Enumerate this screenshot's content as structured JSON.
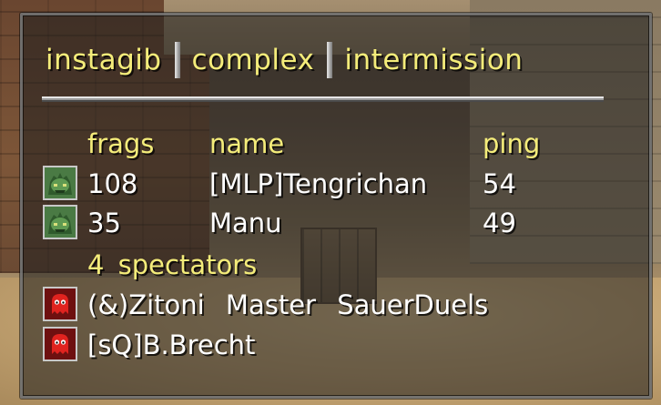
{
  "header": {
    "mode": "instagib",
    "map": "complex",
    "state": "intermission"
  },
  "columns": {
    "frags": "frags",
    "name": "name",
    "ping": "ping"
  },
  "players": [
    {
      "frags": "108",
      "name": "[MLP]Tengrichan",
      "ping": "54",
      "icon": "ogro-player-icon"
    },
    {
      "frags": "35",
      "name": "Manu",
      "ping": "49",
      "icon": "ogro-player-icon"
    }
  ],
  "spectators": {
    "title": "4 spectators",
    "entries": [
      {
        "name": "(&)Zitoni Master SauerDuels",
        "icon": "ghost-spectator-icon"
      },
      {
        "name": "[sQ]B.Brecht",
        "icon": "ghost-spectator-icon"
      }
    ]
  },
  "colors": {
    "accent_yellow": "#f4ec7a",
    "player_text": "#ffffff",
    "spectator_icon_bg": "#7a1414",
    "player_icon_bg": "#3c6a3a"
  }
}
